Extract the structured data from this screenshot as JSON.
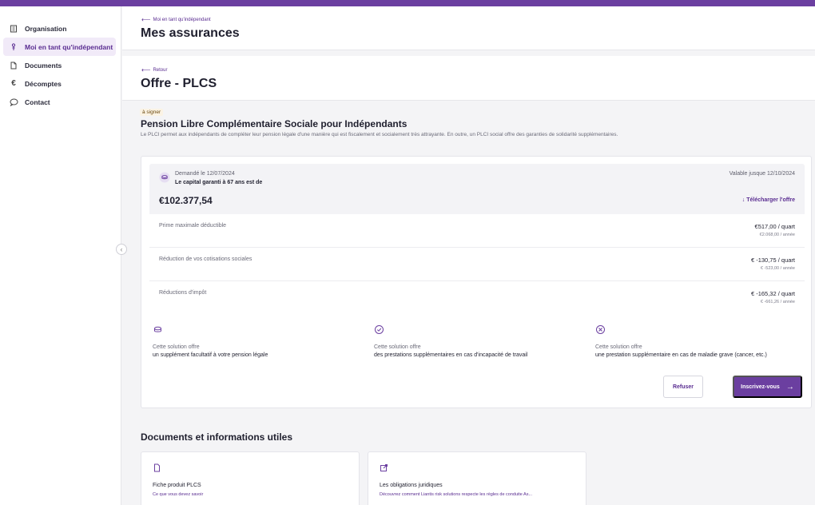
{
  "colors": {
    "accent": "#6b3fa0",
    "accent_dark": "#5a2d91",
    "active_bg": "#f1eaf8"
  },
  "sidebar": {
    "items": [
      {
        "label": "Organisation",
        "icon": "building-icon",
        "active": false
      },
      {
        "label": "Moi en tant qu'indépendant",
        "icon": "person-icon",
        "active": true
      },
      {
        "label": "Documents",
        "icon": "document-icon",
        "active": false
      },
      {
        "label": "Décomptes",
        "icon": "euro-icon",
        "active": false
      },
      {
        "label": "Contact",
        "icon": "chat-icon",
        "active": false
      }
    ]
  },
  "header": {
    "back_label": "Moi en tant qu'indépendant",
    "title": "Mes assurances"
  },
  "subheader": {
    "back_label": "Retour",
    "title": "Offre - PLCS"
  },
  "offer": {
    "status_badge": "à signer",
    "title": "Pension Libre Complémentaire Sociale pour Indépendants",
    "description": "Le PLCI permet aux indépendants de compléter leur pension légale d'une manière qui est fiscalement et socialement très attrayante. En outre, un PLCI social offre des garanties de solidarité supplémentaires.",
    "requested": "Demandé le 12/07/2024",
    "capital_label": "Le capital garanti à 67 ans est de",
    "valid_until": "Valable jusque 12/10/2024",
    "amount": "€102.377,54",
    "download_label": "Télécharger l'offre",
    "rows": [
      {
        "label": "Prime maximale déductible",
        "quarter": "€517,00 / quart",
        "year": "€2.068,00 / année"
      },
      {
        "label": "Réduction de vos cotisations sociales",
        "quarter": "€ -130,75 / quart",
        "year": "€ -523,00 / année"
      },
      {
        "label": "Réductions d'impôt",
        "quarter": "€ -165,32 / quart",
        "year": "€ -661,26 / année"
      }
    ],
    "features": [
      {
        "icon": "coins-icon",
        "title": "Cette solution offre",
        "desc": "un supplément facultatif à votre pension légale"
      },
      {
        "icon": "check-circle-icon",
        "title": "Cette solution offre",
        "desc": "des prestations supplémentaires en cas d'incapacité de travail"
      },
      {
        "icon": "medical-circle-icon",
        "title": "Cette solution offre",
        "desc": "une prestation supplémentaire en cas de maladie grave (cancer, etc.)"
      }
    ],
    "refuse_label": "Refuser",
    "subscribe_label": "Inscrivez-vous"
  },
  "documents": {
    "title": "Documents et informations utiles",
    "items": [
      {
        "icon": "file-icon",
        "title": "Fiche produit PLCS",
        "desc": "Ce que vous devez savoir"
      },
      {
        "icon": "external-link-icon",
        "title": "Les obligations juridiques",
        "desc": "Découvrez comment Liantis risk solutions respecte les règles de conduite As..."
      }
    ]
  }
}
